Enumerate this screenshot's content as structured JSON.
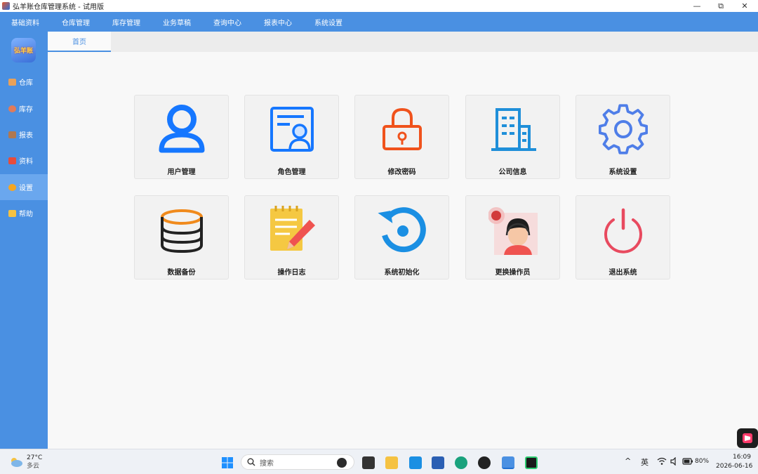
{
  "window": {
    "title": "弘羊账仓库管理系统 - 试用版",
    "minimize_glyph": "—",
    "maximize_glyph": "⧉",
    "close_glyph": "✕"
  },
  "menubar": {
    "items": [
      "基础资料",
      "仓库管理",
      "库存管理",
      "业务草稿",
      "查询中心",
      "报表中心",
      "系统设置"
    ]
  },
  "logo": {
    "text": "弘羊账"
  },
  "sidebar": {
    "items": [
      {
        "label": "仓库",
        "icon": "warehouse-icon",
        "color": "#e8a15a"
      },
      {
        "label": "库存",
        "icon": "stock-icon",
        "color": "#e07b5a"
      },
      {
        "label": "报表",
        "icon": "report-icon",
        "color": "#b07850"
      },
      {
        "label": "资料",
        "icon": "data-icon",
        "color": "#e74c3c"
      },
      {
        "label": "设置",
        "icon": "settings-icon",
        "color": "#f5a623",
        "active": true
      },
      {
        "label": "帮助",
        "icon": "help-icon",
        "color": "#f5c242"
      }
    ]
  },
  "tabs": [
    {
      "label": "首页",
      "active": true
    }
  ],
  "cards": [
    {
      "label": "用户管理",
      "icon": "user-icon",
      "color": "#1677ff"
    },
    {
      "label": "角色管理",
      "icon": "role-icon",
      "color": "#1677ff"
    },
    {
      "label": "修改密码",
      "icon": "lock-icon",
      "color": "#f0521c"
    },
    {
      "label": "公司信息",
      "icon": "building-icon",
      "color": "#1f8fd9"
    },
    {
      "label": "系统设置",
      "icon": "gear-icon",
      "color": "#4f7ee8"
    },
    {
      "label": "数据备份",
      "icon": "database-icon",
      "color": "#f08a1c"
    },
    {
      "label": "操作日志",
      "icon": "log-icon",
      "color": "#f5c842"
    },
    {
      "label": "系统初始化",
      "icon": "reset-icon",
      "color": "#1a8fe3"
    },
    {
      "label": "更换操作员",
      "icon": "operator-icon",
      "color": "#e23d3d"
    },
    {
      "label": "退出系统",
      "icon": "power-icon",
      "color": "#e84a5f"
    }
  ],
  "taskbar": {
    "weather": {
      "temp": "27°C",
      "cond": "多云"
    },
    "search_placeholder": "搜索",
    "ime": "英",
    "battery": "80%",
    "time": "16:09",
    "date": "2026-06-16",
    "tray_up_glyph": "^"
  }
}
